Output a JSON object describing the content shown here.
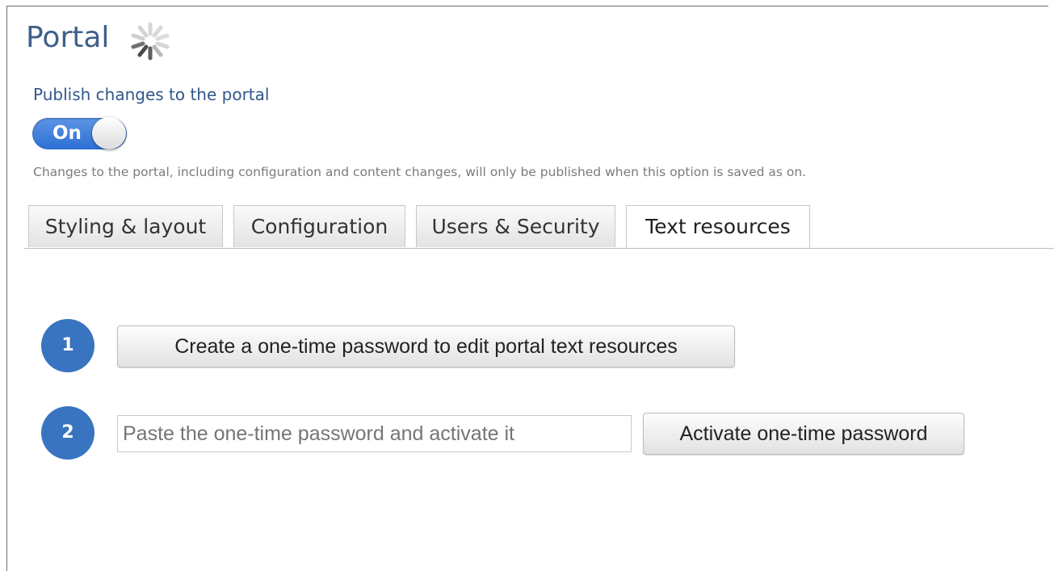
{
  "header": {
    "title": "Portal",
    "spinner_icon": "loading-spinner-icon"
  },
  "publish": {
    "label": "Publish changes to the portal",
    "toggle_state": "On",
    "help_text": "Changes to the portal, including configuration and content changes, will only be published when this option is saved as on."
  },
  "tabs": [
    {
      "label": "Styling & layout",
      "active": false
    },
    {
      "label": "Configuration",
      "active": false
    },
    {
      "label": "Users & Security",
      "active": false
    },
    {
      "label": "Text resources",
      "active": true
    }
  ],
  "steps": [
    {
      "number": "1",
      "button_label": "Create a one-time password to edit portal text resources"
    },
    {
      "number": "2",
      "input_placeholder": "Paste the one-time password and activate it",
      "button_label": "Activate one-time password"
    }
  ],
  "colors": {
    "title": "#3f5f8a",
    "link_blue": "#31578c",
    "toggle_blue": "#2c6fd4",
    "step_badge": "#3874bf"
  }
}
